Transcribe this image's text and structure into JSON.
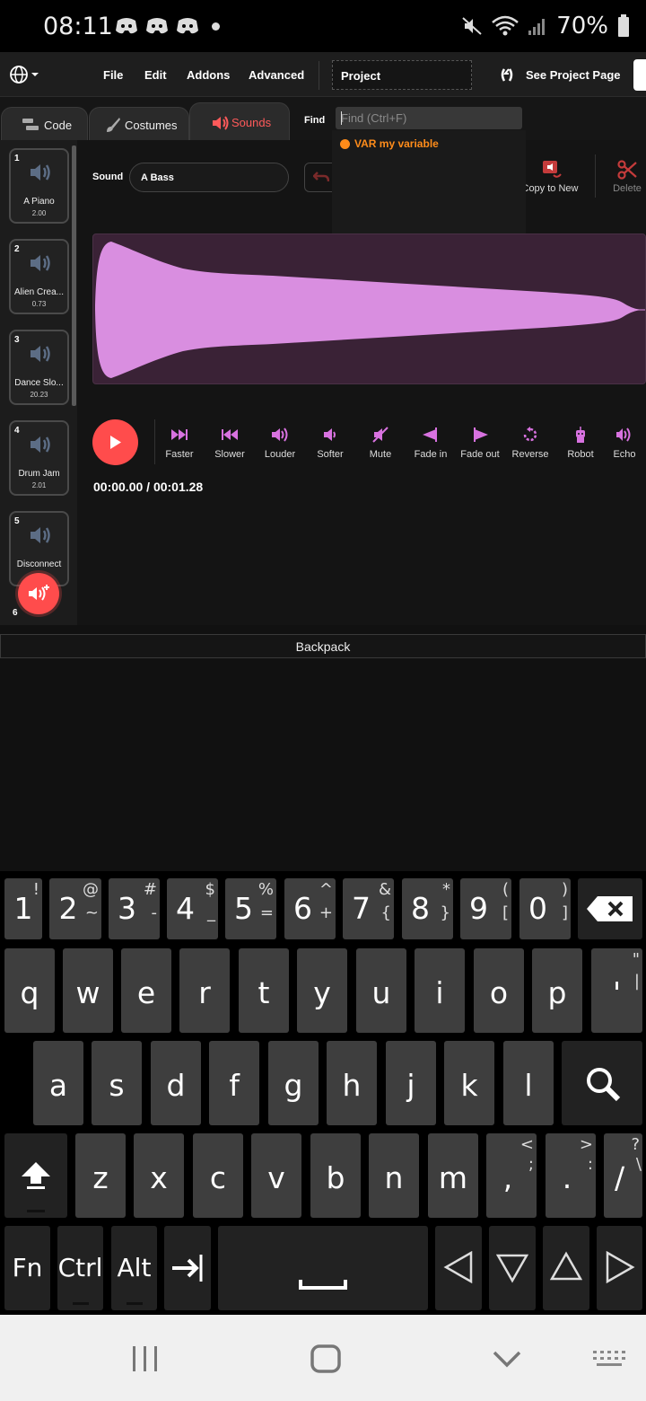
{
  "status": {
    "time": "08:11",
    "battery": "70%"
  },
  "menubar": {
    "file": "File",
    "edit": "Edit",
    "addons": "Addons",
    "advanced": "Advanced",
    "project_title": "Project",
    "see_project": "See Project Page"
  },
  "tabs": [
    {
      "label": "Code"
    },
    {
      "label": "Costumes"
    },
    {
      "label": "Sounds"
    }
  ],
  "find": {
    "label": "Find",
    "placeholder": "Find (Ctrl+F)",
    "result": "VAR my variable"
  },
  "sounds": [
    {
      "num": "1",
      "name": "A Piano",
      "duration": "2.00"
    },
    {
      "num": "2",
      "name": "Alien Crea...",
      "duration": "0.73"
    },
    {
      "num": "3",
      "name": "Dance Slo...",
      "duration": "20.23"
    },
    {
      "num": "4",
      "name": "Drum Jam",
      "duration": "2.01"
    },
    {
      "num": "5",
      "name": "Disconnect",
      "duration": ""
    },
    {
      "num": "6",
      "name": "",
      "duration": ""
    }
  ],
  "editor": {
    "sound_label": "Sound",
    "sound_name": "A Bass",
    "copy_new": "Copy to New",
    "delete": "Delete",
    "timecode": "00:00.00 / 00:01.28"
  },
  "effects": [
    {
      "label": "Faster",
      "icon": "faster-icon"
    },
    {
      "label": "Slower",
      "icon": "slower-icon"
    },
    {
      "label": "Louder",
      "icon": "louder-icon"
    },
    {
      "label": "Softer",
      "icon": "softer-icon"
    },
    {
      "label": "Mute",
      "icon": "mute-icon"
    },
    {
      "label": "Fade in",
      "icon": "fade-in-icon"
    },
    {
      "label": "Fade out",
      "icon": "fade-out-icon"
    },
    {
      "label": "Reverse",
      "icon": "reverse-icon"
    },
    {
      "label": "Robot",
      "icon": "robot-icon"
    },
    {
      "label": "Echo",
      "icon": "echo-icon"
    }
  ],
  "backpack": "Backpack",
  "keyboard": {
    "row1": [
      {
        "main": "1",
        "alt": "!",
        "alt2": "`"
      },
      {
        "main": "2",
        "alt": "@",
        "alt2": "~"
      },
      {
        "main": "3",
        "alt": "#",
        "alt2": "-"
      },
      {
        "main": "4",
        "alt": "$",
        "alt2": "_"
      },
      {
        "main": "5",
        "alt": "%",
        "alt2": "="
      },
      {
        "main": "6",
        "alt": "^",
        "alt2": "+"
      },
      {
        "main": "7",
        "alt": "&",
        "alt2": "{"
      },
      {
        "main": "8",
        "alt": "*",
        "alt2": "}"
      },
      {
        "main": "9",
        "alt": "(",
        "alt2": "["
      },
      {
        "main": "0",
        "alt": ")",
        "alt2": "]"
      }
    ],
    "row2": [
      {
        "main": "q"
      },
      {
        "main": "w"
      },
      {
        "main": "e"
      },
      {
        "main": "r"
      },
      {
        "main": "t"
      },
      {
        "main": "y"
      },
      {
        "main": "u"
      },
      {
        "main": "i"
      },
      {
        "main": "o"
      },
      {
        "main": "p"
      },
      {
        "main": "'",
        "alt": "\"",
        "alt2": "|"
      }
    ],
    "row3": [
      {
        "main": "a"
      },
      {
        "main": "s"
      },
      {
        "main": "d"
      },
      {
        "main": "f"
      },
      {
        "main": "g"
      },
      {
        "main": "h"
      },
      {
        "main": "j"
      },
      {
        "main": "k"
      },
      {
        "main": "l"
      }
    ],
    "row4": [
      {
        "main": "z"
      },
      {
        "main": "x"
      },
      {
        "main": "c"
      },
      {
        "main": "v"
      },
      {
        "main": "b"
      },
      {
        "main": "n"
      },
      {
        "main": "m"
      },
      {
        "main": ",",
        "alt": "<",
        "alt2": ";"
      },
      {
        "main": ".",
        "alt": ">",
        "alt2": ":"
      },
      {
        "main": "/",
        "alt": "?",
        "alt2": "\\"
      }
    ],
    "row5": {
      "fn": "Fn",
      "ctrl": "Ctrl",
      "alt": "Alt"
    }
  },
  "colors": {
    "accent": "#ff4c4c",
    "effect": "#d872e0",
    "waveform": "#d98ee0",
    "orange": "#ff8c1a"
  }
}
